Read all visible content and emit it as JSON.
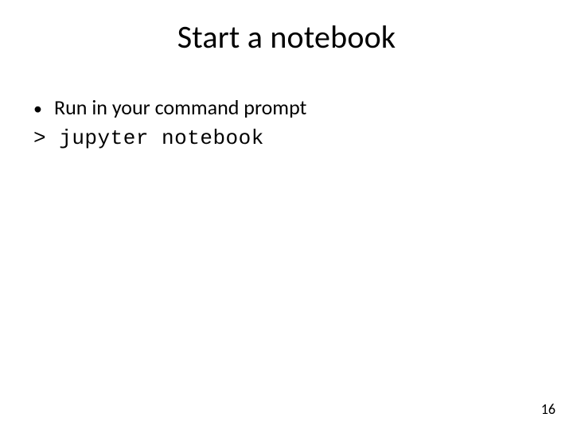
{
  "slide": {
    "title": "Start a notebook",
    "bullets": [
      {
        "text": "Run in your command prompt"
      }
    ],
    "code_prompt": ">",
    "code_command": "jupyter notebook",
    "page_number": "16"
  }
}
